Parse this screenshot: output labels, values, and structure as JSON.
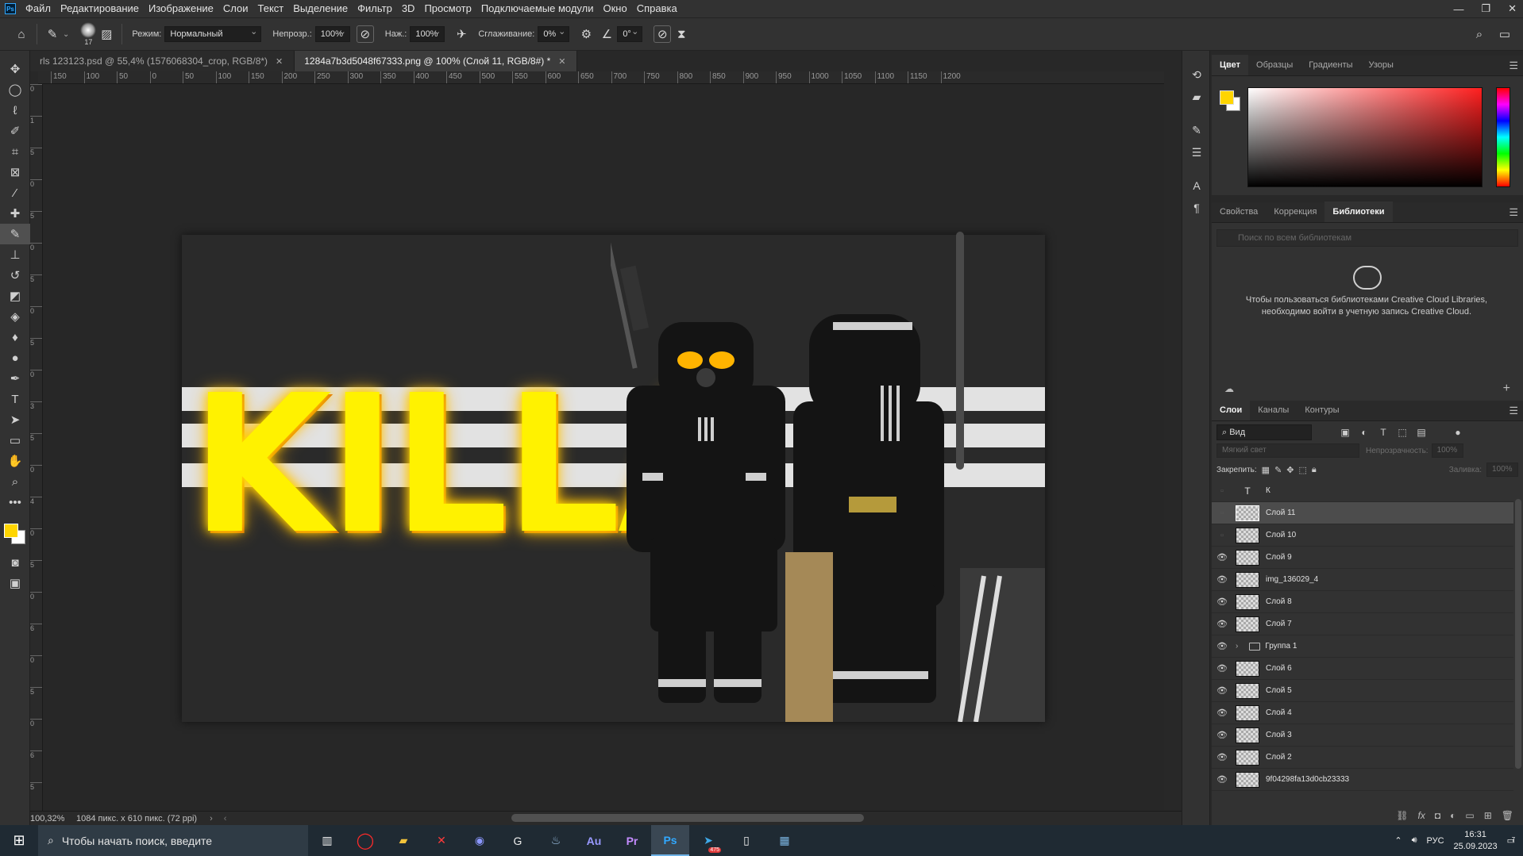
{
  "menu": [
    "Файл",
    "Редактирование",
    "Изображение",
    "Слои",
    "Текст",
    "Выделение",
    "Фильтр",
    "3D",
    "Просмотр",
    "Подключаемые модули",
    "Окно",
    "Справка"
  ],
  "window_controls": {
    "minimize": "—",
    "restore": "❐",
    "close": "✕"
  },
  "options": {
    "brush_size": "17",
    "mode_label": "Режим:",
    "mode_value": "Нормальный",
    "opacity_label": "Непрозр.:",
    "opacity_value": "100%",
    "pressure_label": "Наж.:",
    "pressure_value": "100%",
    "smoothing_label": "Сглаживание:",
    "smoothing_value": "0%",
    "angle_value": "0°"
  },
  "tabs": [
    {
      "label": "rls 123123.psd @ 55,4% (1576068304_crop, RGB/8*)",
      "active": false
    },
    {
      "label": "1284a7b3d5048f67333.png @ 100% (Слой 11, RGB/8#) *",
      "active": true
    }
  ],
  "ruler_top": [
    "150",
    "100",
    "50",
    "0",
    "50",
    "100",
    "150",
    "200",
    "250",
    "300",
    "350",
    "400",
    "450",
    "500",
    "550",
    "600",
    "650",
    "700",
    "750",
    "800",
    "850",
    "900",
    "950",
    "1000",
    "1050",
    "1100",
    "1150",
    "1200"
  ],
  "ruler_left": [
    "0",
    "1",
    "5",
    "0",
    "5",
    "0",
    "5",
    "0",
    "5",
    "0",
    "3",
    "5",
    "0",
    "4",
    "0",
    "5",
    "0",
    "6",
    "0",
    "5",
    "0",
    "6",
    "5",
    "0"
  ],
  "canvas_text": "KILLA",
  "status": {
    "zoom": "100,32%",
    "doc_size": "1084 пикс. x 610 пикс. (72 ppi)"
  },
  "color_panel": {
    "tabs": [
      "Цвет",
      "Образцы",
      "Градиенты",
      "Узоры"
    ],
    "fg_color": "#ffd500",
    "bg_color": "#ffffff"
  },
  "props_panel": {
    "tabs": [
      "Свойства",
      "Коррекция",
      "Библиотеки"
    ],
    "search_placeholder": "Поиск по всем библиотекам",
    "message": "Чтобы пользоваться библиотеками Creative Cloud Libraries, необходимо войти в учетную запись Creative Cloud."
  },
  "layers_panel": {
    "tabs": [
      "Слои",
      "Каналы",
      "Контуры"
    ],
    "kind": "Вид",
    "blend": "Мягкий свет",
    "opacity_label": "Непрозрачность:",
    "opacity_value": "100%",
    "lock_label": "Закрепить:",
    "fill_label": "Заливка:",
    "fill_value": "100%",
    "layers": [
      {
        "name": "К",
        "visible": false,
        "type": "text"
      },
      {
        "name": "Слой 11",
        "visible": false,
        "selected": true
      },
      {
        "name": "Слой 10",
        "visible": false
      },
      {
        "name": "Слой 9",
        "visible": true
      },
      {
        "name": "img_136029_4",
        "visible": true
      },
      {
        "name": "Слой 8",
        "visible": true
      },
      {
        "name": "Слой 7",
        "visible": true
      },
      {
        "name": "Группа 1",
        "visible": true,
        "type": "group"
      },
      {
        "name": "Слой 6",
        "visible": true
      },
      {
        "name": "Слой 5",
        "visible": true
      },
      {
        "name": "Слой 4",
        "visible": true
      },
      {
        "name": "Слой 3",
        "visible": true
      },
      {
        "name": "Слой 2",
        "visible": true
      },
      {
        "name": "9f04298fa13d0cb23333",
        "visible": true
      }
    ]
  },
  "taskbar": {
    "search_placeholder": "Чтобы начать поиск, введите",
    "lang": "РУС",
    "time": "16:31",
    "date": "25.09.2023",
    "apps": [
      "Task View",
      "Opera",
      "Explorer",
      "X",
      "Discord",
      "G",
      "Steam",
      "Au",
      "Pr",
      "Ps",
      "Telegram",
      "Notepad",
      "Calculator"
    ],
    "telegram_badge": "475",
    "notifications": "7"
  }
}
